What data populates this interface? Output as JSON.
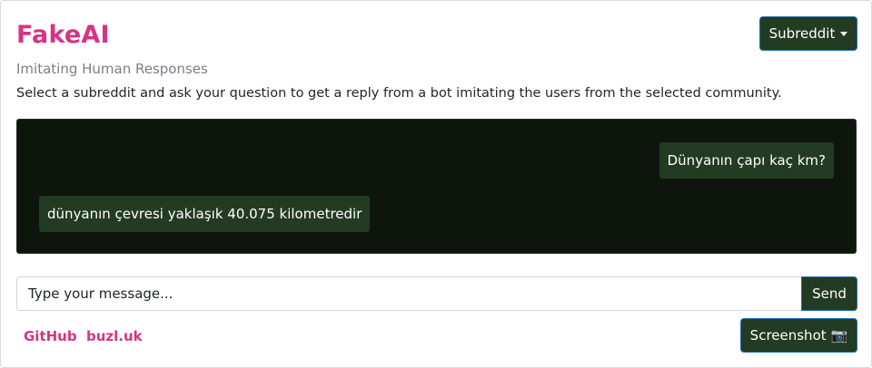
{
  "header": {
    "title": "FakeAI",
    "subtitle": "Imitating Human Responses",
    "description": "Select a subreddit and ask your question to get a reply from a bot imitating the users from the selected community.",
    "subreddit_button_label": "Subreddit"
  },
  "chat": {
    "messages": [
      {
        "role": "user",
        "text": "Dünyanın çapı kaç km?"
      },
      {
        "role": "bot",
        "text": "dünyanın çevresi yaklaşık 40.075 kilometredir"
      }
    ]
  },
  "composer": {
    "placeholder": "Type your message...",
    "value": "",
    "send_label": "Send"
  },
  "footer": {
    "links": [
      {
        "label": "GitHub"
      },
      {
        "label": "buzl.uk"
      }
    ],
    "screenshot_label": "Screenshot",
    "screenshot_icon": "camera-icon"
  },
  "colors": {
    "accent": "#d63384",
    "button_bg": "#233b22",
    "chat_bg": "#0d150d"
  }
}
